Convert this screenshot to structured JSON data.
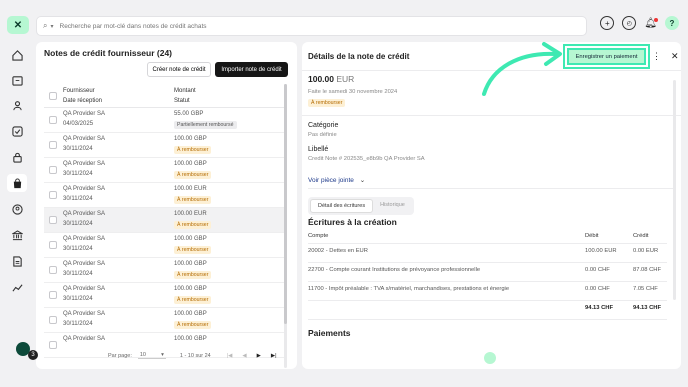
{
  "search": {
    "placeholder": "Recherche par mot-clé dans notes de crédit achats"
  },
  "left": {
    "title": "Notes de crédit fournisseur (24)",
    "create_label": "Créer note de crédit",
    "import_label": "Importer note de crédit",
    "headers": {
      "supplier": "Fournisseur",
      "date": "Date réception",
      "amount": "Montant",
      "status": "Statut"
    },
    "rows": [
      {
        "supplier": "QA Provider SA",
        "date": "04/03/2025",
        "amount": "55.00 GBP",
        "status": "Partiellement remboursé",
        "badge": "gray"
      },
      {
        "supplier": "QA Provider SA",
        "date": "30/11/2024",
        "amount": "100.00 GBP",
        "status": "À rembourser",
        "badge": "orange"
      },
      {
        "supplier": "QA Provider SA",
        "date": "30/11/2024",
        "amount": "100.00 GBP",
        "status": "À rembourser",
        "badge": "orange"
      },
      {
        "supplier": "QA Provider SA",
        "date": "30/11/2024",
        "amount": "100.00 EUR",
        "status": "À rembourser",
        "badge": "orange"
      },
      {
        "supplier": "QA Provider SA",
        "date": "30/11/2024",
        "amount": "100.00 EUR",
        "status": "À rembourser",
        "badge": "orange"
      },
      {
        "supplier": "QA Provider SA",
        "date": "30/11/2024",
        "amount": "100.00 GBP",
        "status": "À rembourser",
        "badge": "orange"
      },
      {
        "supplier": "QA Provider SA",
        "date": "30/11/2024",
        "amount": "100.00 GBP",
        "status": "À rembourser",
        "badge": "orange"
      },
      {
        "supplier": "QA Provider SA",
        "date": "30/11/2024",
        "amount": "100.00 GBP",
        "status": "À rembourser",
        "badge": "orange"
      },
      {
        "supplier": "QA Provider SA",
        "date": "30/11/2024",
        "amount": "100.00 GBP",
        "status": "À rembourser",
        "badge": "orange"
      },
      {
        "supplier": "QA Provider SA",
        "date": "",
        "amount": "100.00 GBP",
        "status": "",
        "badge": "orange"
      }
    ],
    "pager": {
      "per_page_label": "Par page:",
      "per_page": "10",
      "range": "1 - 10 sur 24"
    }
  },
  "right": {
    "title": "Détails de la note de crédit",
    "pay_label": "Enregistrer un paiement",
    "amount": "100.00",
    "currency": "EUR",
    "date_text": "Faite le samedi 30 novembre 2024",
    "status": "À rembourser",
    "category_label": "Catégorie",
    "category_value": "Pas définie",
    "libelle_label": "Libellé",
    "libelle_value": "Credit Note # 202535_e8b9b QA Provider SA",
    "attachment_link": "Voir pièce jointe",
    "tabs": [
      "Détail des écritures",
      "Historique"
    ],
    "entries_title": "Écritures à la création",
    "entries_headers": {
      "account": "Compte",
      "debit": "Débit",
      "credit": "Crédit"
    },
    "entries": [
      {
        "account": "20002 - Dettes en EUR",
        "debit": "100.00 EUR",
        "credit": "0.00 EUR"
      },
      {
        "account": "22700 - Compte courant Institutions de prévoyance professionnelle",
        "debit": "0.00 CHF",
        "credit": "87.08 CHF"
      },
      {
        "account": "11700 - Impôt préalable : TVA s/matériel, marchandises, prestations et énergie",
        "debit": "0.00 CHF",
        "credit": "7.05 CHF"
      }
    ],
    "totals": {
      "debit": "94.13 CHF",
      "credit": "94.13 CHF"
    },
    "payments_title": "Paiements"
  },
  "chat_badge": "3",
  "colors": {
    "accent": "#b6f7d2",
    "highlight": "#3ee9b2"
  }
}
